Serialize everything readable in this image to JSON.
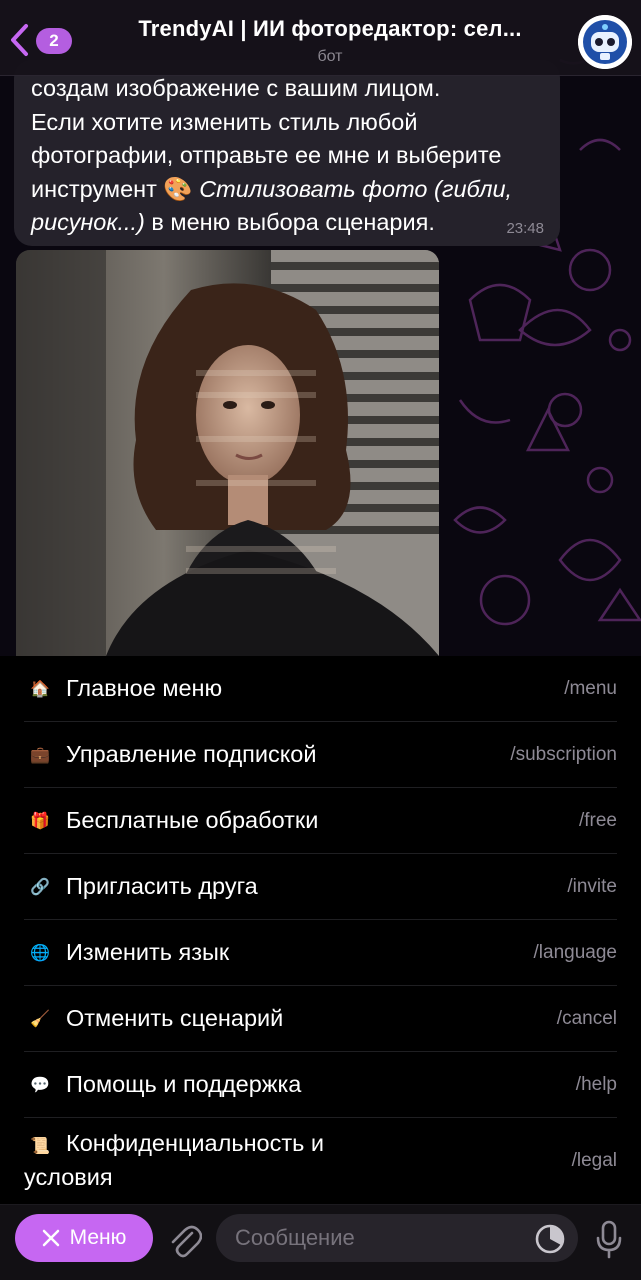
{
  "header": {
    "back_badge": "2",
    "title": "TrendyAI | ИИ фоторедактор: сел...",
    "subtitle": "бот"
  },
  "message": {
    "line1": "создам изображение с вашим лицом.",
    "line2": "Если хотите изменить стиль любой",
    "line3": "фотографии, отправьте ее мне и выберите",
    "line4_prefix": "инструмент ",
    "tool_emoji": "🎨",
    "tool_name_part1": " Стилизовать фото (гибли,",
    "tool_name_part2": "рисунок...)",
    "line5_suffix": " в меню выбора сценария.",
    "time": "23:48"
  },
  "photo": {
    "icon": "portrait-photo"
  },
  "commands": [
    {
      "emoji": "🏠",
      "label": "Главное меню",
      "command": "/menu"
    },
    {
      "emoji": "💼",
      "label": "Управление подпиской",
      "command": "/subscription"
    },
    {
      "emoji": "🎁",
      "label": "Бесплатные обработки",
      "command": "/free"
    },
    {
      "emoji": "🔗",
      "label": "Пригласить друга",
      "command": "/invite"
    },
    {
      "emoji": "🌐",
      "label": "Изменить язык",
      "command": "/language"
    },
    {
      "emoji": "🧹",
      "label": "Отменить сценарий",
      "command": "/cancel"
    },
    {
      "emoji": "💬",
      "label": "Помощь и поддержка",
      "command": "/help"
    },
    {
      "emoji": "📜",
      "label_line1": "Конфиденциальность и",
      "label_line2": "условия",
      "command": "/legal"
    }
  ],
  "input_bar": {
    "menu_button_label": "Меню",
    "placeholder": "Сообщение"
  },
  "colors": {
    "accent": "#c667f2",
    "bubble": "#25222b",
    "header_bg": "#16121a"
  }
}
